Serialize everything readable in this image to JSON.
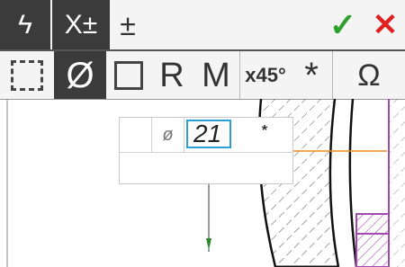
{
  "toolbar_top": {
    "lightning_label": "ϟ",
    "xpm_label": "X±",
    "pm_label": "±",
    "ok_label": "✓",
    "cancel_label": "✕"
  },
  "toolbar_bottom": {
    "dashed_label": "⬚",
    "diameter_label": "Ø",
    "square_label": "☐",
    "radius_label": "R",
    "m_label": "M",
    "chamfer_label": "x45°",
    "star_label": "*",
    "omega_label": "Ω"
  },
  "dimension_panel": {
    "prefix_symbol": "ø",
    "value": "21",
    "suffix_symbol": "*"
  },
  "colors": {
    "toolbar_bg": "#f4f4f4",
    "active_bg": "#3b3b3b",
    "ok": "#2ea02e",
    "cancel": "#e02020",
    "input_border": "#2aa0d8",
    "drawing_orange": "#f08a1c",
    "drawing_purple": "#a24ab0"
  }
}
